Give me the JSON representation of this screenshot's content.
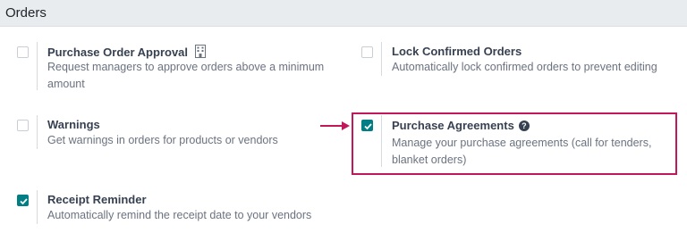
{
  "section": {
    "title": "Orders"
  },
  "settings": {
    "purchase_order_approval": {
      "label": "Purchase Order Approval",
      "description": "Request managers to approve orders above a minimum amount",
      "checked": false,
      "icon": "building-icon"
    },
    "lock_confirmed_orders": {
      "label": "Lock Confirmed Orders",
      "description": "Automatically lock confirmed orders to prevent editing",
      "checked": false
    },
    "warnings": {
      "label": "Warnings",
      "description": "Get warnings in orders for products or vendors",
      "checked": false
    },
    "purchase_agreements": {
      "label": "Purchase Agreements",
      "description": "Manage your purchase agreements (call for tenders, blanket orders)",
      "checked": true,
      "icon": "help-circle-icon"
    },
    "receipt_reminder": {
      "label": "Receipt Reminder",
      "description": "Automatically remind the receipt date to your vendors",
      "checked": true
    }
  },
  "colors": {
    "accent": "#017e84",
    "highlight": "#c2185b",
    "header_bg": "#e9ecef"
  }
}
